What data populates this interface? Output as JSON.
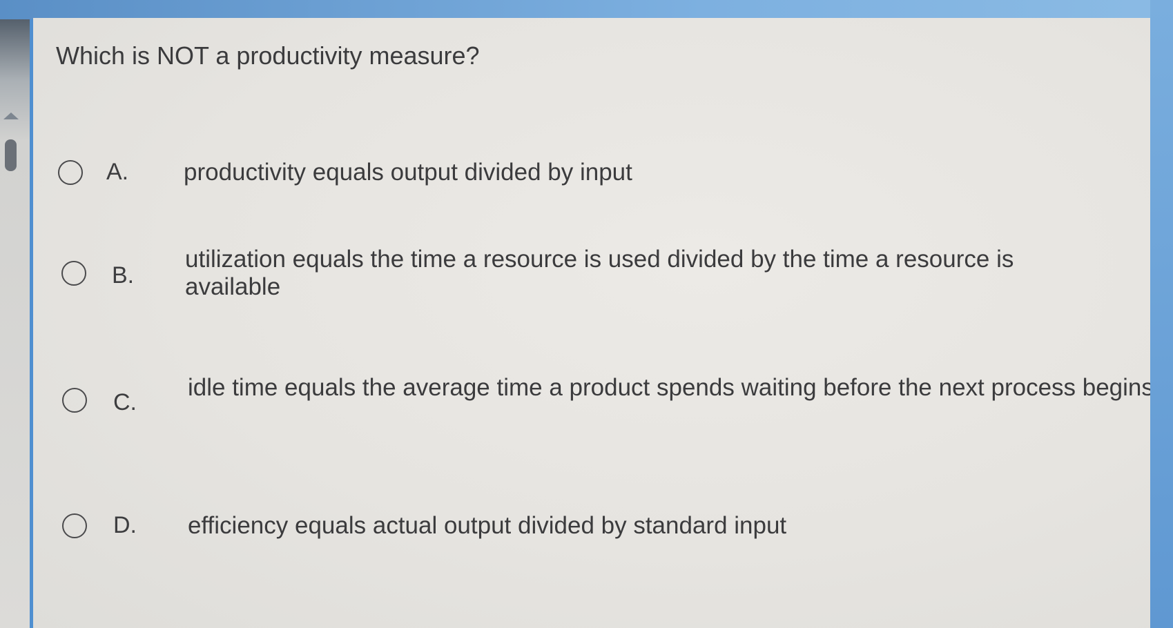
{
  "question": {
    "text": "Which is NOT a productivity measure?"
  },
  "options": [
    {
      "letter": "A.",
      "text": "productivity equals output divided by input",
      "selected": false
    },
    {
      "letter": "B.",
      "text": "utilization equals the time a resource is used divided by the time a resource is available",
      "selected": false
    },
    {
      "letter": "C.",
      "text": "idle time equals the average time a product spends waiting before the next process begins",
      "selected": false
    },
    {
      "letter": "D.",
      "text": "efficiency equals actual output divided by standard input",
      "selected": false
    }
  ],
  "colors": {
    "page_background": "#e6e4e0",
    "text": "#3b3b3d",
    "window_frame": "#6a9fd2"
  },
  "icons": {
    "scroll_up": "triangle-up-icon",
    "radio": "radio-circle-icon"
  }
}
